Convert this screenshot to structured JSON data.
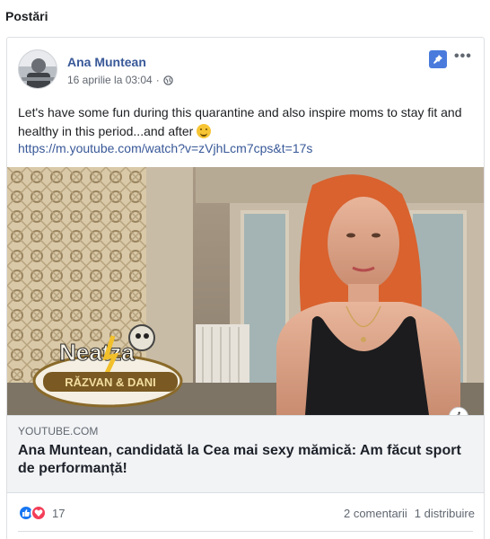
{
  "section": {
    "title": "Postări"
  },
  "post": {
    "author": "Ana Muntean",
    "date": "16 aprilie la 03:04",
    "date_separator": "·",
    "text": "Let's have some fun during this quarantine and also inspire moms to stay fit and healthy in this period...and after",
    "link": "https://m.youtube.com/watch?v=zVjhLcm7cps&t=17s"
  },
  "video": {
    "logo_top": "Neatza",
    "logo_bottom": "RĂZVAN & DANI"
  },
  "preview": {
    "domain": "YOUTUBE.COM",
    "title": "Ana Muntean, candidată la Cea mai sexy mămică: Am făcut sport de performanță!"
  },
  "stats": {
    "reaction_count": "17",
    "comments": "2 comentarii",
    "shares": "1 distribuire"
  },
  "icons": {
    "pin": "pin-icon",
    "more": "more-icon",
    "globe": "globe-icon",
    "info": "info-icon",
    "like": "like-icon",
    "love": "love-icon"
  },
  "colors": {
    "link": "#385898",
    "pin": "#4a7bdc",
    "like": "#1877f2",
    "love": "#f33e58"
  }
}
